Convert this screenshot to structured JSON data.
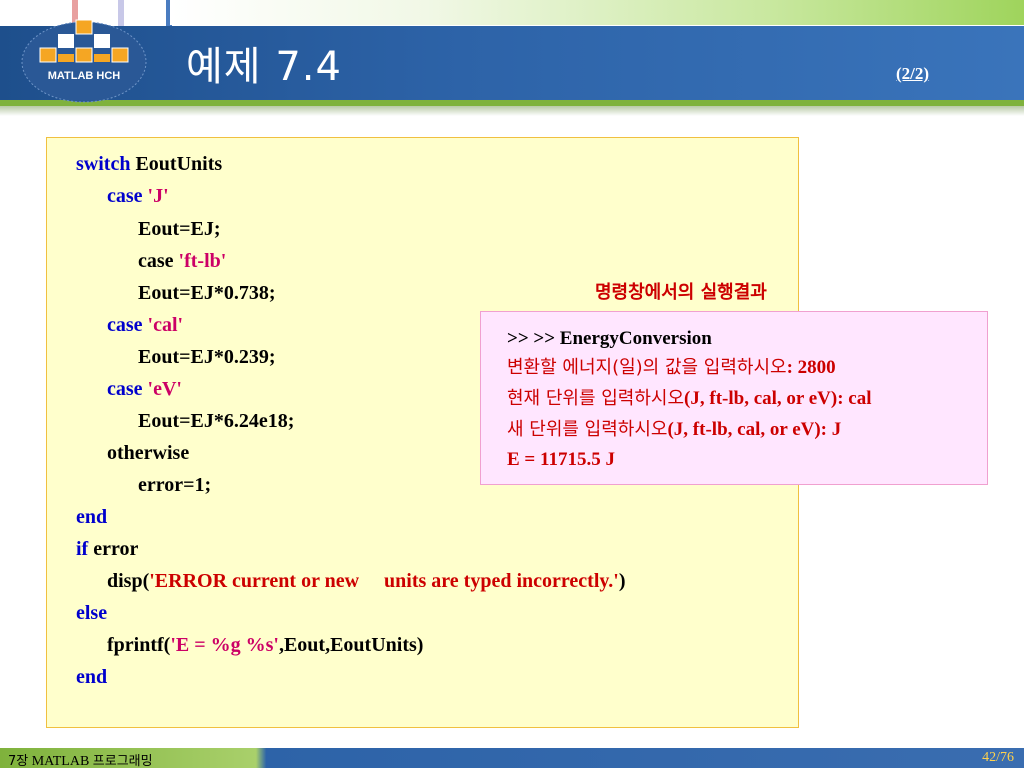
{
  "header": {
    "logo_text": "MATLAB HCH",
    "title": "예제 7.4",
    "page_part": "(2/2)"
  },
  "code": {
    "l1_kw": "switch",
    "l1_rest": " EoutUnits",
    "l2_kw": "case",
    "l2_str": " 'J'",
    "l3": "Eout=EJ;",
    "l4_kw": "case",
    "l4_str": " 'ft-lb'",
    "l5": "Eout=EJ*0.738;",
    "l6_kw": "case",
    "l6_str": " 'cal'",
    "l7": "Eout=EJ*0.239;",
    "l8_kw": "case",
    "l8_str": " 'eV'",
    "l9": "Eout=EJ*6.24e18;",
    "l10": "otherwise",
    "l11": "error=1;",
    "l12_kw": "end",
    "l13_kw": "if",
    "l13_rest": " error",
    "l14_a": "disp(",
    "l14_str": "'ERROR current or new     units are typed incorrectly.'",
    "l14_b": ")",
    "l15_kw": "else",
    "l16_a": "fprintf(",
    "l16_str": "'E = %g %s'",
    "l16_b": ",Eout,EoutUnits)",
    "l17_kw": "end"
  },
  "result": {
    "label": "명령창에서의 실행결과",
    "line1": ">> >> EnergyConversion",
    "line2_ko": "변환할 에너지(일)의 값을 입력하시오",
    "line2_rest": ": 2800",
    "line3_ko": "현재 단위를 입력하시오",
    "line3_rest": "(J, ft-lb, cal, or eV): cal",
    "line4_ko": "새 단위를 입력하시오",
    "line4_rest": "(J, ft-lb, cal, or eV): J",
    "line5": "E = 11715.5 J"
  },
  "footer": {
    "chapter_prefix": "7장",
    "chapter_name": " MATLAB ",
    "chapter_ko": "프로그래밍",
    "page": "42/76"
  },
  "colors": {
    "header_blue": "#2d63a8",
    "accent_green": "#7fb23c",
    "keyword_blue": "#0000cc",
    "string_magenta": "#cc0066",
    "result_red": "#cc0000",
    "code_bg": "#ffffcc",
    "result_bg": "#ffe6ff"
  }
}
